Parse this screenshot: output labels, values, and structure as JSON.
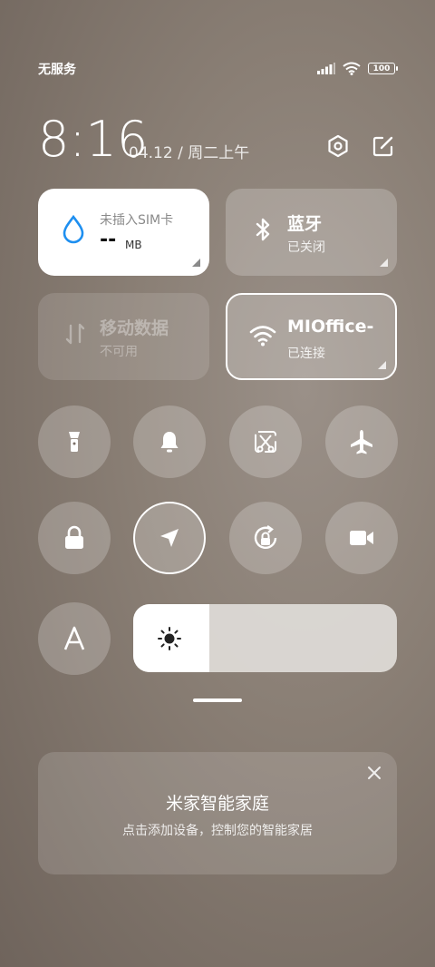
{
  "status_bar": {
    "carrier": "无服务",
    "battery": "100"
  },
  "header": {
    "time": "8:16",
    "date": "04.12 / 周二上午"
  },
  "tiles": {
    "data_usage": {
      "title": "未插入SIM卡",
      "value": "--",
      "unit": "MB"
    },
    "bluetooth": {
      "title": "蓝牙",
      "status": "已关闭"
    },
    "mobile_data": {
      "title": "移动数据",
      "status": "不可用"
    },
    "wifi": {
      "title": "MIOffice-",
      "status": "已连接"
    }
  },
  "toggles": [
    {
      "name": "flashlight",
      "icon": "flashlight-icon",
      "active": false
    },
    {
      "name": "silent",
      "icon": "bell-icon",
      "active": false
    },
    {
      "name": "screenshot",
      "icon": "scissors-screenshot-icon",
      "active": false
    },
    {
      "name": "airplane",
      "icon": "airplane-icon",
      "active": false
    },
    {
      "name": "lock-screen",
      "icon": "lock-icon",
      "active": false
    },
    {
      "name": "location",
      "icon": "location-arrow-icon",
      "active": true
    },
    {
      "name": "rotation-lock",
      "icon": "rotation-lock-icon",
      "active": false
    },
    {
      "name": "screen-record",
      "icon": "video-camera-icon",
      "active": false
    },
    {
      "name": "font",
      "icon": "font-a-icon",
      "active": false
    }
  ],
  "brightness": {
    "level_percent": 29
  },
  "mijia_card": {
    "title": "米家智能家庭",
    "subtitle": "点击添加设备，控制您的智能家居"
  },
  "colors": {
    "accent_blue": "#1e8ff0"
  }
}
